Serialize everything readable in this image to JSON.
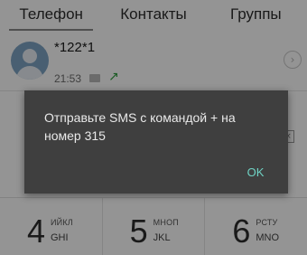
{
  "tabs": [
    {
      "label": "Телефон",
      "active": true
    },
    {
      "label": "Контакты",
      "active": false
    },
    {
      "label": "Группы",
      "active": false
    }
  ],
  "recent_call": {
    "number": "*122*1",
    "time": "21:53",
    "direction_icon": "outgoing-call-arrow",
    "sim_icon": "sim-card",
    "info_icon": "chevron-right"
  },
  "dialpad": {
    "keys": [
      {
        "digit": "4",
        "cyrillic": "ИЙКЛ",
        "latin": "GHI"
      },
      {
        "digit": "5",
        "cyrillic": "МНОП",
        "latin": "JKL"
      },
      {
        "digit": "6",
        "cyrillic": "РСТУ",
        "latin": "MNO"
      }
    ]
  },
  "dialog": {
    "message": "Отправьте SMS с командой + на номер 315",
    "ok_label": "OK"
  },
  "colors": {
    "dialog_bg": "#3f3f3f",
    "dialog_text": "#e9e9e9",
    "accent": "#6fd3c4",
    "outgoing": "#2e9e3e"
  }
}
